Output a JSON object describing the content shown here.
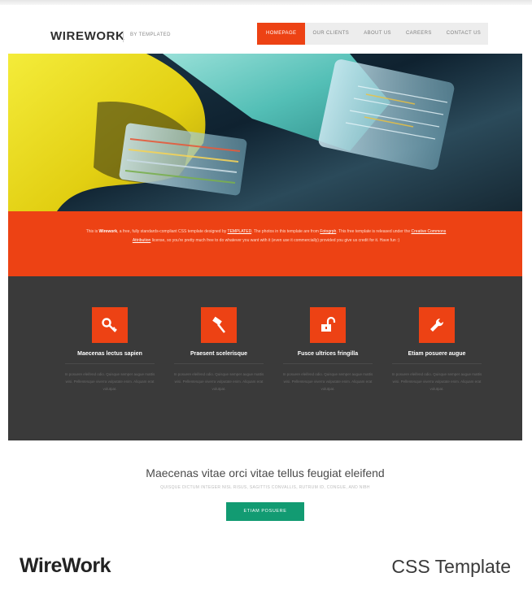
{
  "header": {
    "logo": "WIREWORK",
    "logo_sub": "BY TEMPLATED"
  },
  "nav": {
    "items": [
      "HOMEPAGE",
      "OUR CLIENTS",
      "ABOUT US",
      "CAREERS",
      "CONTACT US"
    ],
    "active": "HOMEPAGE"
  },
  "banner": {
    "part1": "This is ",
    "name": "Wirework",
    "part2": ", a free, fully standards-compliant CSS template designed by ",
    "link1": "TEMPLATED",
    "part3": ". The photos in this template are from ",
    "link2": "Fotogrph",
    "part4": ". This free template is released under the ",
    "link3": "Creative Commons Attribution",
    "part5": " license, so you're pretty much free to do whatever you want with it (even use it commercially) provided you give us credit for it. Have fun :)"
  },
  "features": [
    {
      "icon": "key-icon",
      "title": "Maecenas lectus sapien",
      "text": "In posuere eleifend odio. Quisque semper augue mattis wisi. Pellentesque viverra vulputate enim. Aliquam erat volutpat."
    },
    {
      "icon": "gavel-icon",
      "title": "Praesent scelerisque",
      "text": "In posuere eleifend odio. Quisque semper augue mattis wisi. Pellentesque viverra vulputate enim. Aliquam erat volutpat."
    },
    {
      "icon": "unlock-icon",
      "title": "Fusce ultrices fringilla",
      "text": "In posuere eleifend odio. Quisque semper augue mattis wisi. Pellentesque viverra vulputate enim. Aliquam erat volutpat."
    },
    {
      "icon": "wrench-icon",
      "title": "Etiam posuere augue",
      "text": "In posuere eleifend odio. Quisque semper augue mattis wisi. Pellentesque viverra vulputate enim. Aliquam erat volutpat."
    }
  ],
  "main": {
    "title": "Maecenas vitae orci vitae tellus feugiat eleifend",
    "subtitle": "Quisque dictum integer nisl risus, sagittis convallis, rutrum id, congue, and nibh",
    "button": "ETIAM POSUERE"
  },
  "caption": {
    "left": "WireWork",
    "right": "CSS Template"
  },
  "colors": {
    "accent": "#ed4214",
    "dark": "#3a3a3a",
    "button": "#129b72"
  }
}
